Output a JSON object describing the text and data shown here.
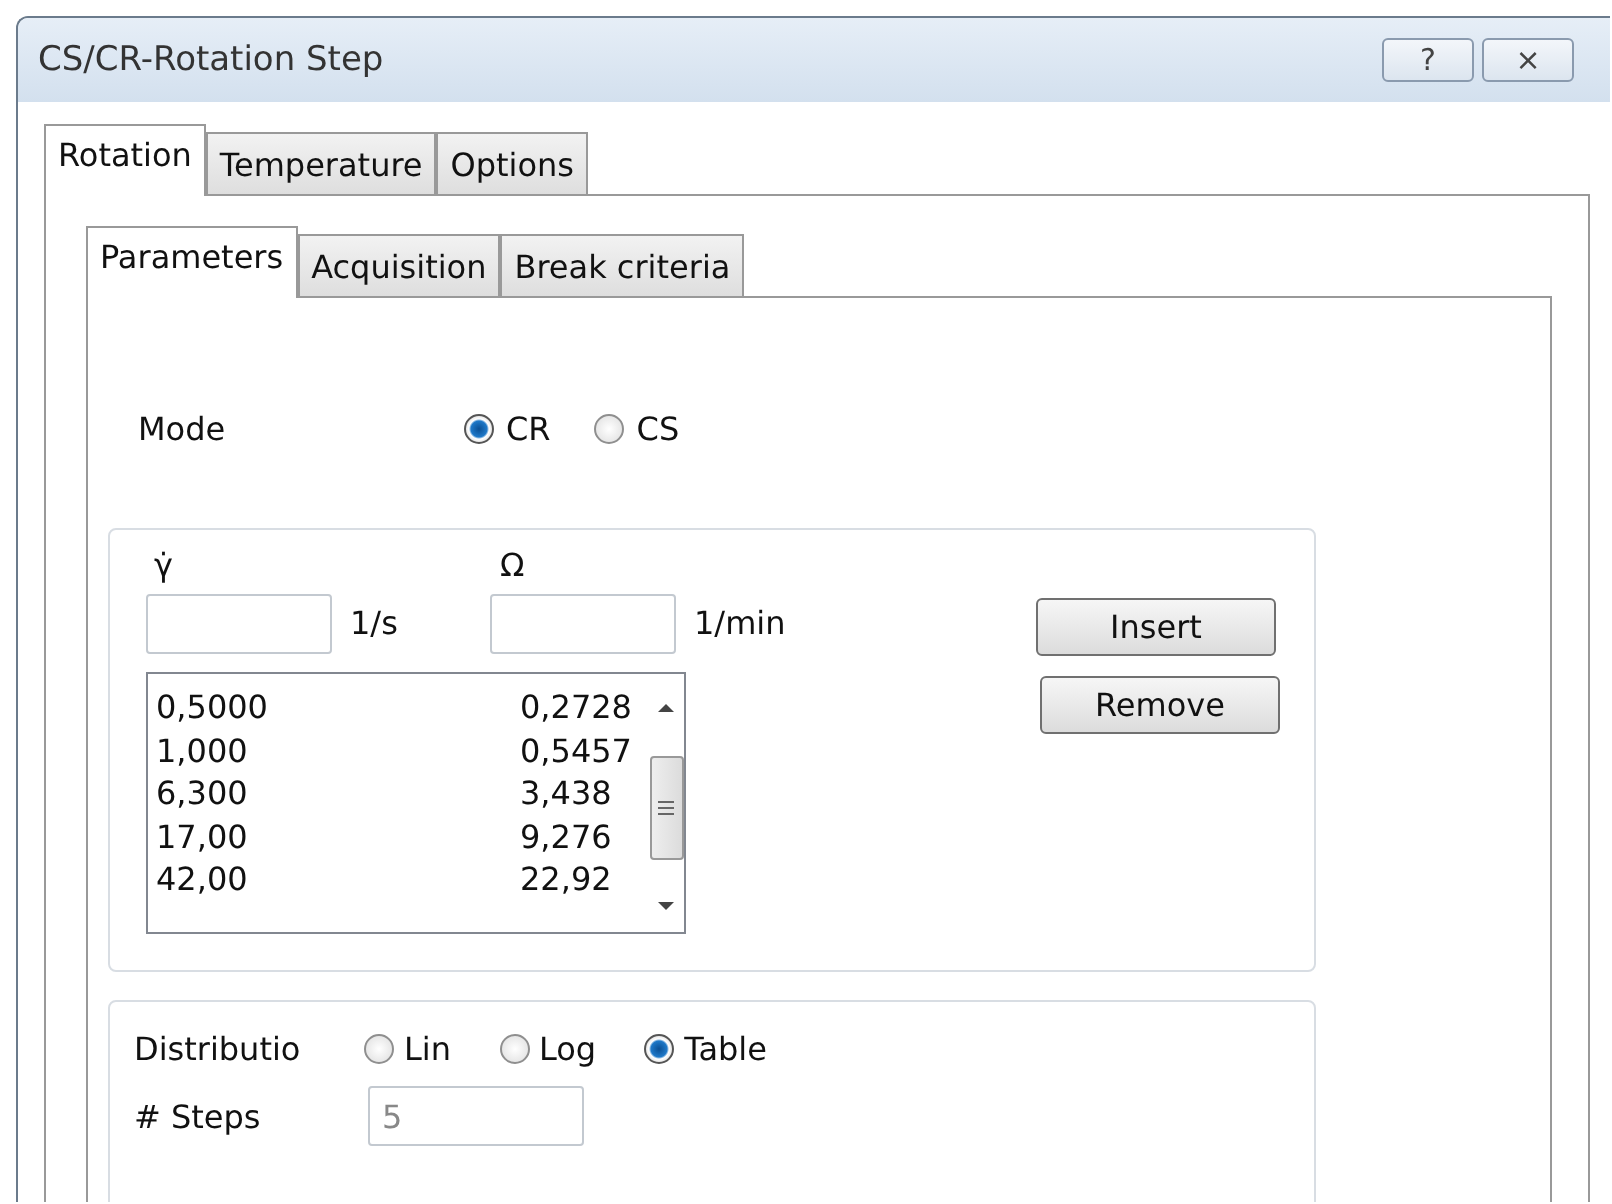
{
  "window": {
    "title": "CS/CR-Rotation Step",
    "buttons": [
      "?",
      "×"
    ]
  },
  "tabs": [
    {
      "label": "Rotation",
      "selected": true
    },
    {
      "label": "Temperature",
      "selected": false
    },
    {
      "label": "Options",
      "selected": false
    }
  ],
  "subtabs": [
    {
      "label": "Parameters",
      "selected": true
    },
    {
      "label": "Acquisition",
      "selected": false
    },
    {
      "label": "Break criteria",
      "selected": false
    }
  ],
  "mode": {
    "label": "Mode",
    "options": [
      {
        "label": "CR",
        "selected": true
      },
      {
        "label": "CS",
        "selected": false
      }
    ]
  },
  "points": {
    "shear_rate_label": "γ̇",
    "shear_rate_unit": "1/s",
    "speed_label": "Ω",
    "speed_unit": "1/min",
    "rows": [
      {
        "shear_rate": "0,5000",
        "speed": "0,2728"
      },
      {
        "shear_rate": "1,000",
        "speed": "0,5457"
      },
      {
        "shear_rate": "6,300",
        "speed": "3,438"
      },
      {
        "shear_rate": "17,00",
        "speed": "9,276"
      },
      {
        "shear_rate": "42,00",
        "speed": "22,92"
      }
    ],
    "buttons": [
      "Insert",
      "Remove"
    ]
  },
  "distribution": {
    "label": "Distributio",
    "options": [
      {
        "label": "Lin",
        "selected": false
      },
      {
        "label": "Log",
        "selected": false
      },
      {
        "label": "Table",
        "selected": true
      }
    ],
    "steps_label": "# Steps",
    "steps_value": "5",
    "steps_disabled": true
  }
}
